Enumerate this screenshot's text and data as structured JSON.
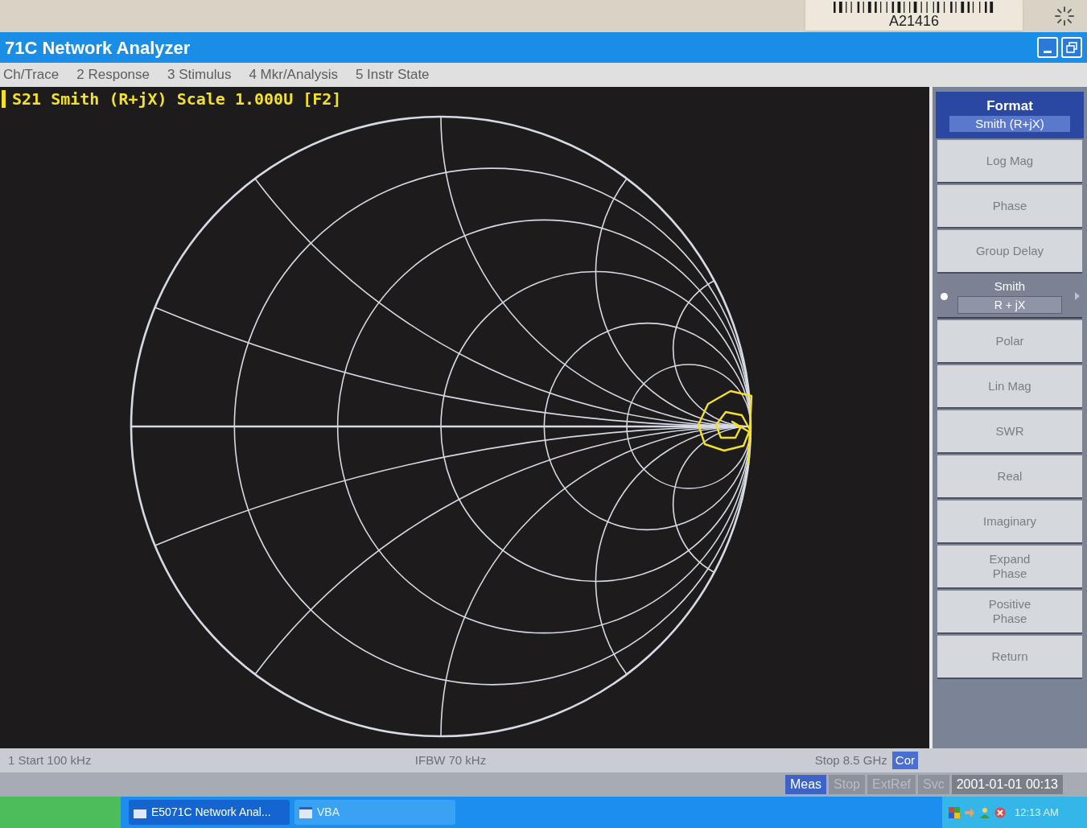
{
  "bezel": {
    "asset_label": "A21416"
  },
  "window": {
    "title": "71C Network Analyzer"
  },
  "menu": [
    "Ch/Trace",
    "2 Response",
    "3 Stimulus",
    "4 Mkr/Analysis",
    "5 Instr State"
  ],
  "trace_title": "S21 Smith (R+jX) Scale 1.000U [F2]",
  "softkeys": {
    "title": "Format",
    "value": "Smith (R+jX)",
    "items": [
      {
        "label": "Log Mag",
        "selected": false
      },
      {
        "label": "Phase",
        "selected": false
      },
      {
        "label": "Group Delay",
        "selected": false
      },
      {
        "label": "Smith",
        "sublabel": "R + jX",
        "selected": true
      },
      {
        "label": "Polar",
        "selected": false
      },
      {
        "label": "Lin Mag",
        "selected": false
      },
      {
        "label": "SWR",
        "selected": false
      },
      {
        "label": "Real",
        "selected": false
      },
      {
        "label": "Imaginary",
        "selected": false
      },
      {
        "label": "Expand\nPhase",
        "selected": false
      },
      {
        "label": "Positive\nPhase",
        "selected": false
      },
      {
        "label": "Return",
        "selected": false
      }
    ]
  },
  "channel_footer": {
    "start": "1 Start 100 kHz",
    "ifbw": "IFBW 70 kHz",
    "stop": "Stop 8.5 GHz",
    "correction": "Cor"
  },
  "status_bar": {
    "indicators": [
      {
        "label": "Meas",
        "active": true
      },
      {
        "label": "Stop",
        "active": false
      },
      {
        "label": "ExtRef",
        "active": false
      },
      {
        "label": "Svc",
        "active": false
      }
    ],
    "datetime": "2001-01-01 00:13"
  },
  "taskbar": {
    "tasks": [
      {
        "label": "E5071C Network Anal...",
        "selected": true
      },
      {
        "label": "VBA",
        "selected": false
      }
    ],
    "clock": "12:13 AM"
  }
}
